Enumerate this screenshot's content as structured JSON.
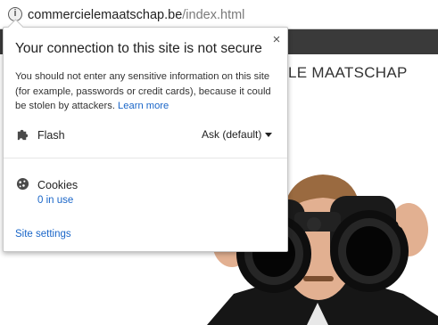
{
  "address_bar": {
    "url_host": "commercielemaatschap.be",
    "url_path": "/index.html",
    "info_icon": "info-circle-icon"
  },
  "page": {
    "title": "LE MAATSCHAP",
    "navbar_color": "#3a3a3a"
  },
  "popup": {
    "title": "Your connection to this site is not secure",
    "close_glyph": "×",
    "description": "You should not enter any sensitive information on this site (for example, passwords or credit cards), because it could be stolen by attackers.",
    "learn_more": "Learn more",
    "permissions": [
      {
        "icon": "puzzle-piece-icon",
        "label": "Flash",
        "value": "Ask (default)"
      }
    ],
    "cookies": {
      "icon": "cookie-icon",
      "label": "Cookies",
      "count": "0 in use"
    },
    "site_settings": "Site settings",
    "link_color": "#1a66c8"
  }
}
